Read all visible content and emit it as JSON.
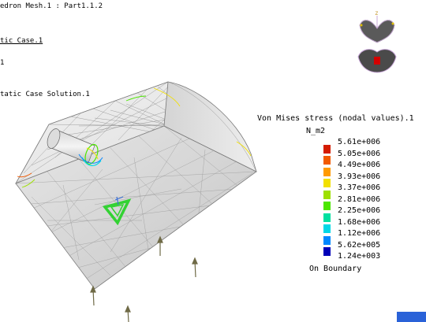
{
  "tree": {
    "mesh_label": "edron Mesh.1 : Part1.1.2",
    "case_label": "tic Case.1",
    "item_label": "1",
    "solution_label": "tatic Case Solution.1"
  },
  "legend": {
    "title": "Von Mises stress (nodal values).1",
    "unit": "N_m2",
    "entries": [
      {
        "value": "5.61e+006",
        "color": null
      },
      {
        "value": "5.05e+006",
        "color": "#d41c00"
      },
      {
        "value": "4.49e+006",
        "color": "#f25a00"
      },
      {
        "value": "3.93e+006",
        "color": "#ff9a00"
      },
      {
        "value": "3.37e+006",
        "color": "#f2e000"
      },
      {
        "value": "2.81e+006",
        "color": "#9ee000"
      },
      {
        "value": "2.25e+006",
        "color": "#4ce600"
      },
      {
        "value": "1.68e+006",
        "color": "#00e0a0"
      },
      {
        "value": "1.12e+006",
        "color": "#00d8e6"
      },
      {
        "value": "5.62e+005",
        "color": "#0088ff"
      },
      {
        "value": "1.24e+003",
        "color": "#0000b8"
      }
    ],
    "footer": "On Boundary"
  },
  "compass": {
    "z_label": "z"
  }
}
